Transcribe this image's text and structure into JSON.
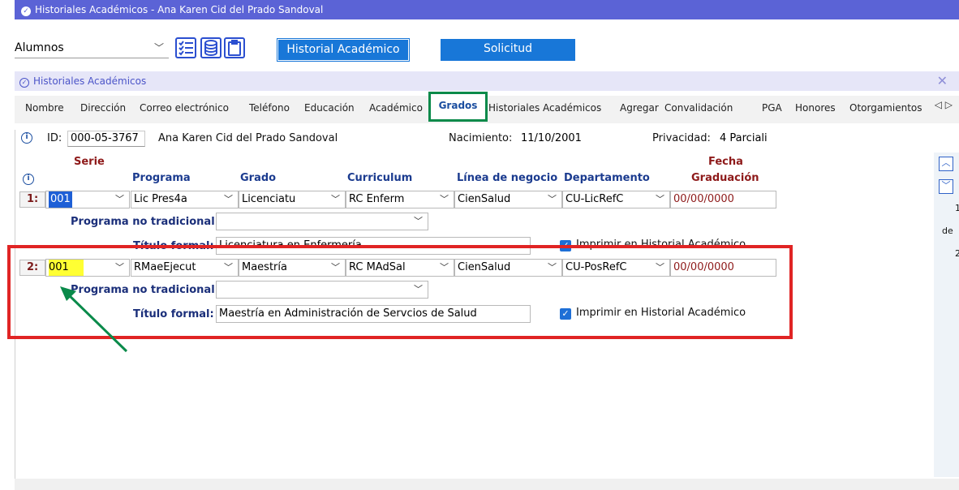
{
  "window": {
    "title": "Historiales Académicos -  Ana Karen Cid del Prado Sandoval"
  },
  "module": {
    "selected": "Alumnos"
  },
  "toolbar": {
    "historial_label": "Historial Académico",
    "solicitud_label": "Solicitud"
  },
  "subwindow": {
    "title": "Historiales Académicos",
    "close": "✕"
  },
  "tabs": [
    {
      "label": "Nombre"
    },
    {
      "label": "Dirección"
    },
    {
      "label": "Correo electrónico"
    },
    {
      "label": "Teléfono"
    },
    {
      "label": "Educación"
    },
    {
      "label": "Académico"
    },
    {
      "label": "Grados"
    },
    {
      "label": "Historiales Académicos"
    },
    {
      "label": "Agregar"
    },
    {
      "label": "Convalidación"
    },
    {
      "label": "PGA"
    },
    {
      "label": "Honores"
    },
    {
      "label": "Otorgamientos"
    }
  ],
  "tab_arrows": "◁ ▷",
  "info": {
    "id_label": "ID:",
    "id_value": "000-05-3767",
    "name": "Ana Karen Cid del Prado Sandoval",
    "birth_label": "Nacimiento:",
    "birth_value": "11/10/2001",
    "privacy_label": "Privacidad:",
    "privacy_value": "4 Parciali"
  },
  "headers": {
    "serie": "Serie",
    "programa": "Programa",
    "grado": "Grado",
    "curriculum": "Curriculum",
    "linea": "Línea de negocio",
    "departamento": "Departamento",
    "fecha1": "Fecha",
    "fecha2": "Graduación"
  },
  "labels": {
    "programa_no_trad": "Programa no tradicional:",
    "titulo_formal": "Título formal:",
    "imprimir": "Imprimir en Historial Académico"
  },
  "rows": [
    {
      "num": "1:",
      "serie": "001",
      "programa": "Lic Pres4a",
      "grado": "Licenciatu",
      "curriculum": "RC Enferm",
      "linea": "CienSalud",
      "departamento": "CU-LicRefC",
      "fecha": "00/00/0000",
      "programa_no_trad": "",
      "titulo_formal": "Licenciatura en Enfermería",
      "imprimir": true
    },
    {
      "num": "2:",
      "serie": "001",
      "programa": "RMaeEjecut",
      "grado": "Maestría",
      "curriculum": "RC MAdSal",
      "linea": "CienSalud",
      "departamento": "CU-PosRefC",
      "fecha": "00/00/0000",
      "programa_no_trad": "",
      "titulo_formal": "Maestría en Administración de Servcios de Salud",
      "imprimir": true
    }
  ],
  "right_panel": {
    "line1": "1",
    "line2": "de",
    "line3": "2"
  },
  "colors": {
    "titlebar": "#5b63d6",
    "accent_blue": "#1877d8",
    "annotation_red": "#e02424",
    "annotation_green": "#0a8a4a",
    "highlight": "#ffff33"
  }
}
